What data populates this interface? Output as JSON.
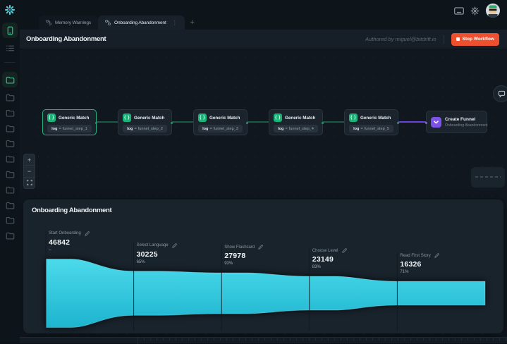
{
  "topbar": {
    "tabs": [
      {
        "label": "Memory Warnings",
        "active": false
      },
      {
        "label": "Onboarding Abandonment",
        "active": true
      }
    ],
    "new_tab": "+"
  },
  "header": {
    "title": "Onboarding Abandonment",
    "authored": "Authored by miguel@bitdrift.io",
    "stop_label": "Stop Workflow"
  },
  "workflow": {
    "match_nodes": [
      {
        "title": "Generic Match",
        "condition_key": "log",
        "condition_op": "=",
        "condition_value": "funnel_step_1",
        "selected": true
      },
      {
        "title": "Generic Match",
        "condition_key": "log",
        "condition_op": "=",
        "condition_value": "funnel_step_2",
        "selected": false
      },
      {
        "title": "Generic Match",
        "condition_key": "log",
        "condition_op": "=",
        "condition_value": "funnel_step_3",
        "selected": false
      },
      {
        "title": "Generic Match",
        "condition_key": "log",
        "condition_op": "=",
        "condition_value": "funnel_step_4",
        "selected": false
      },
      {
        "title": "Generic Match",
        "condition_key": "log",
        "condition_op": "=",
        "condition_value": "funnel_step_5",
        "selected": false
      }
    ],
    "match_icon_glyph": "{ }",
    "output_node": {
      "title": "Create Funnel",
      "subtitle": "Onboarding Abandonment"
    }
  },
  "zoom_controls": {
    "zoom_in": "+",
    "zoom_out": "−"
  },
  "funnel_panel": {
    "title": "Onboarding Abandonment"
  },
  "chart_data": {
    "type": "area",
    "variant": "funnel",
    "title": "Onboarding Abandonment",
    "stages": [
      "Start Onboarding",
      "Select Language",
      "Show Flashcard",
      "Choose Level",
      "Read First Story"
    ],
    "values": [
      46842,
      30225,
      27978,
      23149,
      16326
    ],
    "conversion_pcts": [
      "–",
      "65%",
      "93%",
      "83%",
      "71%"
    ],
    "fill_top": "#4cdaeb",
    "fill_bottom": "#1db4cf"
  },
  "colors": {
    "accent_green": "#17b377",
    "accent_purple": "#7d52e8",
    "stop_button": "#ee4f2e",
    "funnel_cyan": "#3bd2e6"
  }
}
